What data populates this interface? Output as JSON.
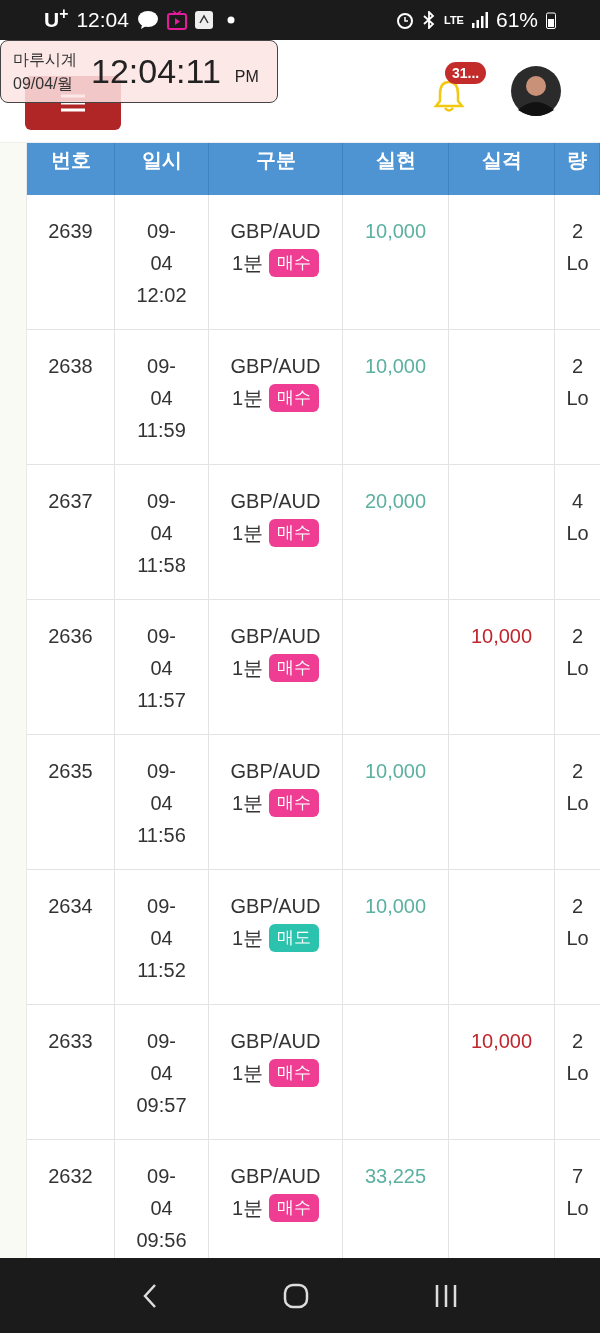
{
  "status_bar": {
    "carrier": "U$^{+}$",
    "time": "12:04",
    "network": "LTE",
    "battery": "61%"
  },
  "clock_widget": {
    "title": "마루시계",
    "date": "09/04/월",
    "time": "12:04:11",
    "meridiem": "PM"
  },
  "header": {
    "notification_badge": "31..."
  },
  "table": {
    "columns": [
      "번호",
      "일시",
      "구분",
      "실현",
      "실격",
      "량"
    ],
    "rows": [
      {
        "number": "2639",
        "datetime": [
          "09-",
          "04",
          "12:02"
        ],
        "pair": "GBP/AUD",
        "period": "1분",
        "side": {
          "label": "매수",
          "kind": "buy"
        },
        "realized": "10,000",
        "loss": "",
        "column_6": [
          "2",
          "Lo"
        ]
      },
      {
        "number": "2638",
        "datetime": [
          "09-",
          "04",
          "11:59"
        ],
        "pair": "GBP/AUD",
        "period": "1분",
        "side": {
          "label": "매수",
          "kind": "buy"
        },
        "realized": "10,000",
        "loss": "",
        "column_6": [
          "2",
          "Lo"
        ]
      },
      {
        "number": "2637",
        "datetime": [
          "09-",
          "04",
          "11:58"
        ],
        "pair": "GBP/AUD",
        "period": "1분",
        "side": {
          "label": "매수",
          "kind": "buy"
        },
        "realized": "20,000",
        "loss": "",
        "column_6": [
          "4",
          "Lo"
        ]
      },
      {
        "number": "2636",
        "datetime": [
          "09-",
          "04",
          "11:57"
        ],
        "pair": "GBP/AUD",
        "period": "1분",
        "side": {
          "label": "매수",
          "kind": "buy"
        },
        "realized": "",
        "loss": "10,000",
        "column_6": [
          "2",
          "Lo"
        ]
      },
      {
        "number": "2635",
        "datetime": [
          "09-",
          "04",
          "11:56"
        ],
        "pair": "GBP/AUD",
        "period": "1분",
        "side": {
          "label": "매수",
          "kind": "buy"
        },
        "realized": "10,000",
        "loss": "",
        "column_6": [
          "2",
          "Lo"
        ]
      },
      {
        "number": "2634",
        "datetime": [
          "09-",
          "04",
          "11:52"
        ],
        "pair": "GBP/AUD",
        "period": "1분",
        "side": {
          "label": "매도",
          "kind": "sell"
        },
        "realized": "10,000",
        "loss": "",
        "column_6": [
          "2",
          "Lo"
        ]
      },
      {
        "number": "2633",
        "datetime": [
          "09-",
          "04",
          "09:57"
        ],
        "pair": "GBP/AUD",
        "period": "1분",
        "side": {
          "label": "매수",
          "kind": "buy"
        },
        "realized": "",
        "loss": "10,000",
        "column_6": [
          "2",
          "Lo"
        ]
      },
      {
        "number": "2632",
        "datetime": [
          "09-",
          "04",
          "09:56"
        ],
        "pair": "GBP/AUD",
        "period": "1분",
        "side": {
          "label": "매수",
          "kind": "buy"
        },
        "realized": "33,225",
        "loss": "",
        "column_6": [
          "7",
          "Lo"
        ]
      }
    ]
  }
}
